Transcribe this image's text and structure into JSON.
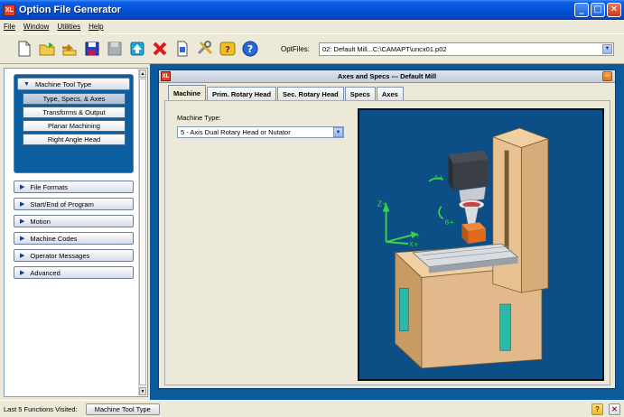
{
  "window": {
    "title": "Option File Generator",
    "app_icon_text": "XL",
    "controls": {
      "minimize": "_",
      "maximize": "□",
      "close": "✕"
    }
  },
  "menu": [
    "File",
    "Window",
    "Utilities",
    "Help"
  ],
  "toolbar": {
    "icons": [
      "new-file-icon",
      "open-folder-icon",
      "undo-icon",
      "save-icon",
      "save-disabled-icon",
      "upload-icon",
      "delete-icon",
      "document-icon",
      "tools-icon",
      "help-wizard-icon",
      "help-icon"
    ],
    "optfiles_label": "OptFiles:",
    "optfiles_value": "02: Default Mill...C:\\CAMAPT\\uncx01.p02"
  },
  "nav": {
    "expanded_section": "Machine Tool Type",
    "sub_items": [
      "Type, Specs, & Axes",
      "Transforms & Output",
      "Planar Machining",
      "Right Angle Head"
    ],
    "active_sub_item": "Type, Specs, & Axes",
    "sections": [
      "File Formats",
      "Start/End of Program",
      "Motion",
      "Machine Codes",
      "Operator Messages",
      "Advanced"
    ]
  },
  "inner_window": {
    "title": "Axes and Specs --- Default Mill",
    "icon_text": "XL",
    "tabs": [
      "Machine",
      "Prim. Rotary Head",
      "Sec. Rotary Head",
      "Specs",
      "Axes"
    ],
    "active_tab": "Machine",
    "machine_type_label": "Machine Type:",
    "machine_type_value": "5 - Axis Dual Rotary Head or Nutator",
    "axis_labels": {
      "z": "Z+",
      "y": "Y+",
      "x": "X+",
      "a": "A+",
      "b": "B+"
    }
  },
  "status": {
    "label": "Last 5 Functions Visited:",
    "button": "Machine Tool Type",
    "help_icon_text": "?",
    "close_icon_text": "✕"
  },
  "colors": {
    "titlebar": "#0553d6",
    "workspace": "#0b5b9c",
    "nav_expanded": "#0b5fa0",
    "machine_body": "#e2b98a",
    "axis_green": "#39d24a",
    "part_orange": "#e06a1a"
  }
}
